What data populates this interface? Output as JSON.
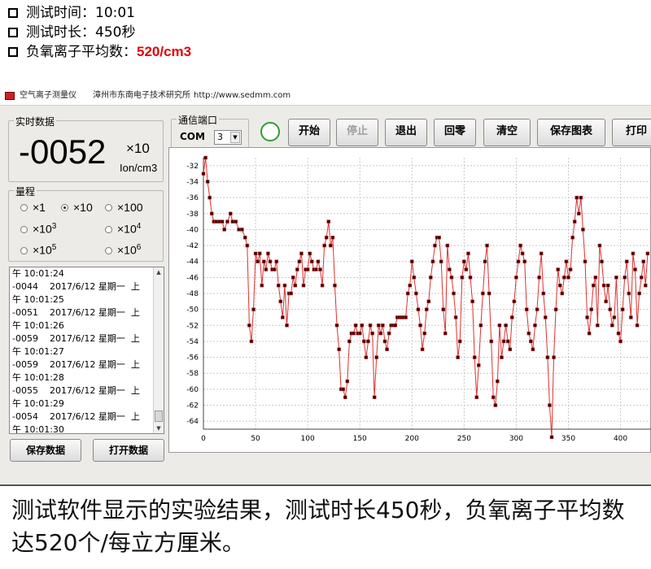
{
  "info": {
    "line1": "测试时间：10:01",
    "line2": "测试时长：450秒",
    "line3_prefix": "负氧离子平均数：",
    "line3_value": "520/cm3"
  },
  "window": {
    "title_app": "空气离子测量仪",
    "title_org": "漳州市东南电子技术研究所",
    "title_url": "http://www.sedmm.com"
  },
  "realtime": {
    "group_label": "实时数据",
    "value": "-0052",
    "multiplier": "×10",
    "unit": "Ion/cm3"
  },
  "range": {
    "group_label": "量程",
    "options": [
      {
        "label": "×1",
        "sup": "",
        "selected": false
      },
      {
        "label": "×10",
        "sup": "",
        "selected": true
      },
      {
        "label": "×100",
        "sup": "",
        "selected": false
      },
      {
        "label": "×10",
        "sup": "3",
        "selected": false
      },
      {
        "label": "×10",
        "sup": "4",
        "selected": false
      },
      {
        "label": "×10",
        "sup": "5",
        "selected": false
      },
      {
        "label": "×10",
        "sup": "6",
        "selected": false
      }
    ]
  },
  "port": {
    "group_label": "通信端口",
    "label": "COM",
    "value": "3"
  },
  "toolbar": {
    "start": "开始",
    "stop": "停止",
    "exit": "退出",
    "zero": "回零",
    "clear": "清空",
    "save_chart": "保存图表",
    "print": "打印"
  },
  "log": [
    "午 10:01:24",
    "-0044    2017/6/12 星期一  上",
    "午 10:01:25",
    "-0051    2017/6/12 星期一  上",
    "午 10:01:26",
    "-0059    2017/6/12 星期一  上",
    "午 10:01:27",
    "-0059    2017/6/12 星期一  上",
    "午 10:01:28",
    "-0055    2017/6/12 星期一  上",
    "午 10:01:29",
    "-0054    2017/6/12 星期一  上",
    "午 10:01:30"
  ],
  "bottom_buttons": {
    "save_data": "保存数据",
    "open_data": "打开数据"
  },
  "caption": "测试软件显示的实验结果，测试时长450秒，负氧离子平均数达520个/每立方厘米。",
  "colors": {
    "series": "#e03030",
    "marker": "#3a0a0a",
    "indicator": "#2ea02e",
    "highlight": "#e00000"
  },
  "chart_data": {
    "type": "line",
    "xlim": [
      0,
      430
    ],
    "ylim": [
      -65,
      -31
    ],
    "xticks": [
      0,
      50,
      100,
      150,
      200,
      250,
      300,
      350,
      400
    ],
    "yticks": [
      -32,
      -34,
      -36,
      -38,
      -40,
      -42,
      -44,
      -46,
      -48,
      -50,
      -52,
      -54,
      -56,
      -58,
      -60,
      -62,
      -64
    ],
    "grid": true,
    "series": [
      {
        "points": [
          [
            0,
            -33
          ],
          [
            2,
            -31
          ],
          [
            4,
            -34
          ],
          [
            6,
            -36
          ],
          [
            8,
            -38
          ],
          [
            10,
            -39
          ],
          [
            12,
            -39
          ],
          [
            15,
            -39
          ],
          [
            18,
            -39
          ],
          [
            20,
            -40
          ],
          [
            23,
            -39
          ],
          [
            26,
            -38
          ],
          [
            28,
            -39
          ],
          [
            31,
            -39
          ],
          [
            34,
            -40
          ],
          [
            37,
            -40
          ],
          [
            40,
            -41
          ],
          [
            42,
            -42
          ],
          [
            44,
            -52
          ],
          [
            46,
            -54
          ],
          [
            48,
            -50
          ],
          [
            50,
            -43
          ],
          [
            52,
            -44
          ],
          [
            54,
            -43
          ],
          [
            56,
            -47
          ],
          [
            58,
            -44
          ],
          [
            60,
            -45
          ],
          [
            62,
            -43
          ],
          [
            64,
            -44
          ],
          [
            66,
            -45
          ],
          [
            68,
            -45
          ],
          [
            70,
            -44
          ],
          [
            72,
            -47
          ],
          [
            74,
            -49
          ],
          [
            76,
            -51
          ],
          [
            78,
            -47
          ],
          [
            80,
            -52
          ],
          [
            82,
            -48
          ],
          [
            84,
            -48
          ],
          [
            86,
            -46
          ],
          [
            88,
            -47
          ],
          [
            90,
            -45
          ],
          [
            92,
            -44
          ],
          [
            94,
            -43
          ],
          [
            96,
            -47
          ],
          [
            98,
            -45
          ],
          [
            100,
            -45
          ],
          [
            102,
            -43
          ],
          [
            104,
            -44
          ],
          [
            106,
            -45
          ],
          [
            108,
            -45
          ],
          [
            110,
            -44
          ],
          [
            112,
            -45
          ],
          [
            114,
            -47
          ],
          [
            116,
            -42
          ],
          [
            118,
            -41
          ],
          [
            120,
            -39
          ],
          [
            122,
            -42
          ],
          [
            124,
            -41
          ],
          [
            126,
            -47
          ],
          [
            128,
            -52
          ],
          [
            130,
            -55
          ],
          [
            132,
            -60
          ],
          [
            134,
            -60
          ],
          [
            136,
            -61
          ],
          [
            138,
            -59
          ],
          [
            140,
            -54
          ],
          [
            142,
            -53
          ],
          [
            144,
            -53
          ],
          [
            146,
            -52
          ],
          [
            148,
            -53
          ],
          [
            150,
            -53
          ],
          [
            152,
            -52
          ],
          [
            154,
            -54
          ],
          [
            156,
            -56
          ],
          [
            158,
            -54
          ],
          [
            160,
            -52
          ],
          [
            162,
            -53
          ],
          [
            164,
            -61
          ],
          [
            166,
            -56
          ],
          [
            168,
            -52
          ],
          [
            170,
            -53
          ],
          [
            172,
            -52
          ],
          [
            174,
            -54
          ],
          [
            176,
            -55
          ],
          [
            178,
            -53
          ],
          [
            180,
            -52
          ],
          [
            182,
            -52
          ],
          [
            184,
            -52
          ],
          [
            186,
            -51
          ],
          [
            188,
            -51
          ],
          [
            190,
            -51
          ],
          [
            192,
            -51
          ],
          [
            194,
            -51
          ],
          [
            196,
            -48
          ],
          [
            198,
            -47
          ],
          [
            200,
            -44
          ],
          [
            202,
            -46
          ],
          [
            204,
            -48
          ],
          [
            206,
            -50
          ],
          [
            208,
            -52
          ],
          [
            210,
            -55
          ],
          [
            212,
            -53
          ],
          [
            214,
            -50
          ],
          [
            216,
            -49
          ],
          [
            218,
            -46
          ],
          [
            220,
            -44
          ],
          [
            222,
            -42
          ],
          [
            224,
            -41
          ],
          [
            226,
            -41
          ],
          [
            228,
            -44
          ],
          [
            230,
            -50
          ],
          [
            232,
            -53
          ],
          [
            234,
            -42
          ],
          [
            236,
            -45
          ],
          [
            238,
            -46
          ],
          [
            240,
            -48
          ],
          [
            242,
            -51
          ],
          [
            244,
            -56
          ],
          [
            246,
            -54
          ],
          [
            248,
            -46
          ],
          [
            250,
            -44
          ],
          [
            252,
            -45
          ],
          [
            254,
            -43
          ],
          [
            256,
            -46
          ],
          [
            258,
            -49
          ],
          [
            260,
            -56
          ],
          [
            262,
            -61
          ],
          [
            264,
            -57
          ],
          [
            266,
            -52
          ],
          [
            268,
            -48
          ],
          [
            270,
            -44
          ],
          [
            272,
            -42
          ],
          [
            274,
            -48
          ],
          [
            276,
            -54
          ],
          [
            278,
            -61
          ],
          [
            280,
            -62
          ],
          [
            282,
            -59
          ],
          [
            284,
            -52
          ],
          [
            286,
            -56
          ],
          [
            288,
            -54
          ],
          [
            290,
            -52
          ],
          [
            292,
            -54
          ],
          [
            294,
            -55
          ],
          [
            296,
            -51
          ],
          [
            298,
            -49
          ],
          [
            300,
            -46
          ],
          [
            302,
            -44
          ],
          [
            304,
            -42
          ],
          [
            306,
            -43
          ],
          [
            308,
            -44
          ],
          [
            310,
            -50
          ],
          [
            312,
            -53
          ],
          [
            314,
            -54
          ],
          [
            316,
            -55
          ],
          [
            318,
            -52
          ],
          [
            320,
            -50
          ],
          [
            322,
            -46
          ],
          [
            324,
            -43
          ],
          [
            326,
            -48
          ],
          [
            328,
            -51
          ],
          [
            330,
            -56
          ],
          [
            332,
            -62
          ],
          [
            334,
            -66
          ],
          [
            336,
            -56
          ],
          [
            338,
            -50
          ],
          [
            340,
            -45
          ],
          [
            342,
            -47
          ],
          [
            344,
            -48
          ],
          [
            346,
            -46
          ],
          [
            348,
            -44
          ],
          [
            350,
            -46
          ],
          [
            352,
            -45
          ],
          [
            354,
            -41
          ],
          [
            356,
            -39
          ],
          [
            358,
            -36
          ],
          [
            360,
            -38
          ],
          [
            362,
            -36
          ],
          [
            364,
            -40
          ],
          [
            366,
            -44
          ],
          [
            368,
            -51
          ],
          [
            370,
            -53
          ],
          [
            372,
            -50
          ],
          [
            374,
            -47
          ],
          [
            376,
            -46
          ],
          [
            378,
            -52
          ],
          [
            380,
            -42
          ],
          [
            382,
            -44
          ],
          [
            384,
            -47
          ],
          [
            386,
            -49
          ],
          [
            388,
            -47
          ],
          [
            390,
            -50
          ],
          [
            392,
            -52
          ],
          [
            394,
            -51
          ],
          [
            396,
            -46
          ],
          [
            398,
            -53
          ],
          [
            400,
            -54
          ],
          [
            402,
            -50
          ],
          [
            404,
            -46
          ],
          [
            406,
            -44
          ],
          [
            408,
            -48
          ],
          [
            410,
            -51
          ],
          [
            412,
            -43
          ],
          [
            414,
            -45
          ],
          [
            416,
            -52
          ],
          [
            418,
            -48
          ],
          [
            420,
            -46
          ],
          [
            422,
            -44
          ],
          [
            424,
            -47
          ],
          [
            426,
            -43
          ]
        ]
      }
    ]
  }
}
